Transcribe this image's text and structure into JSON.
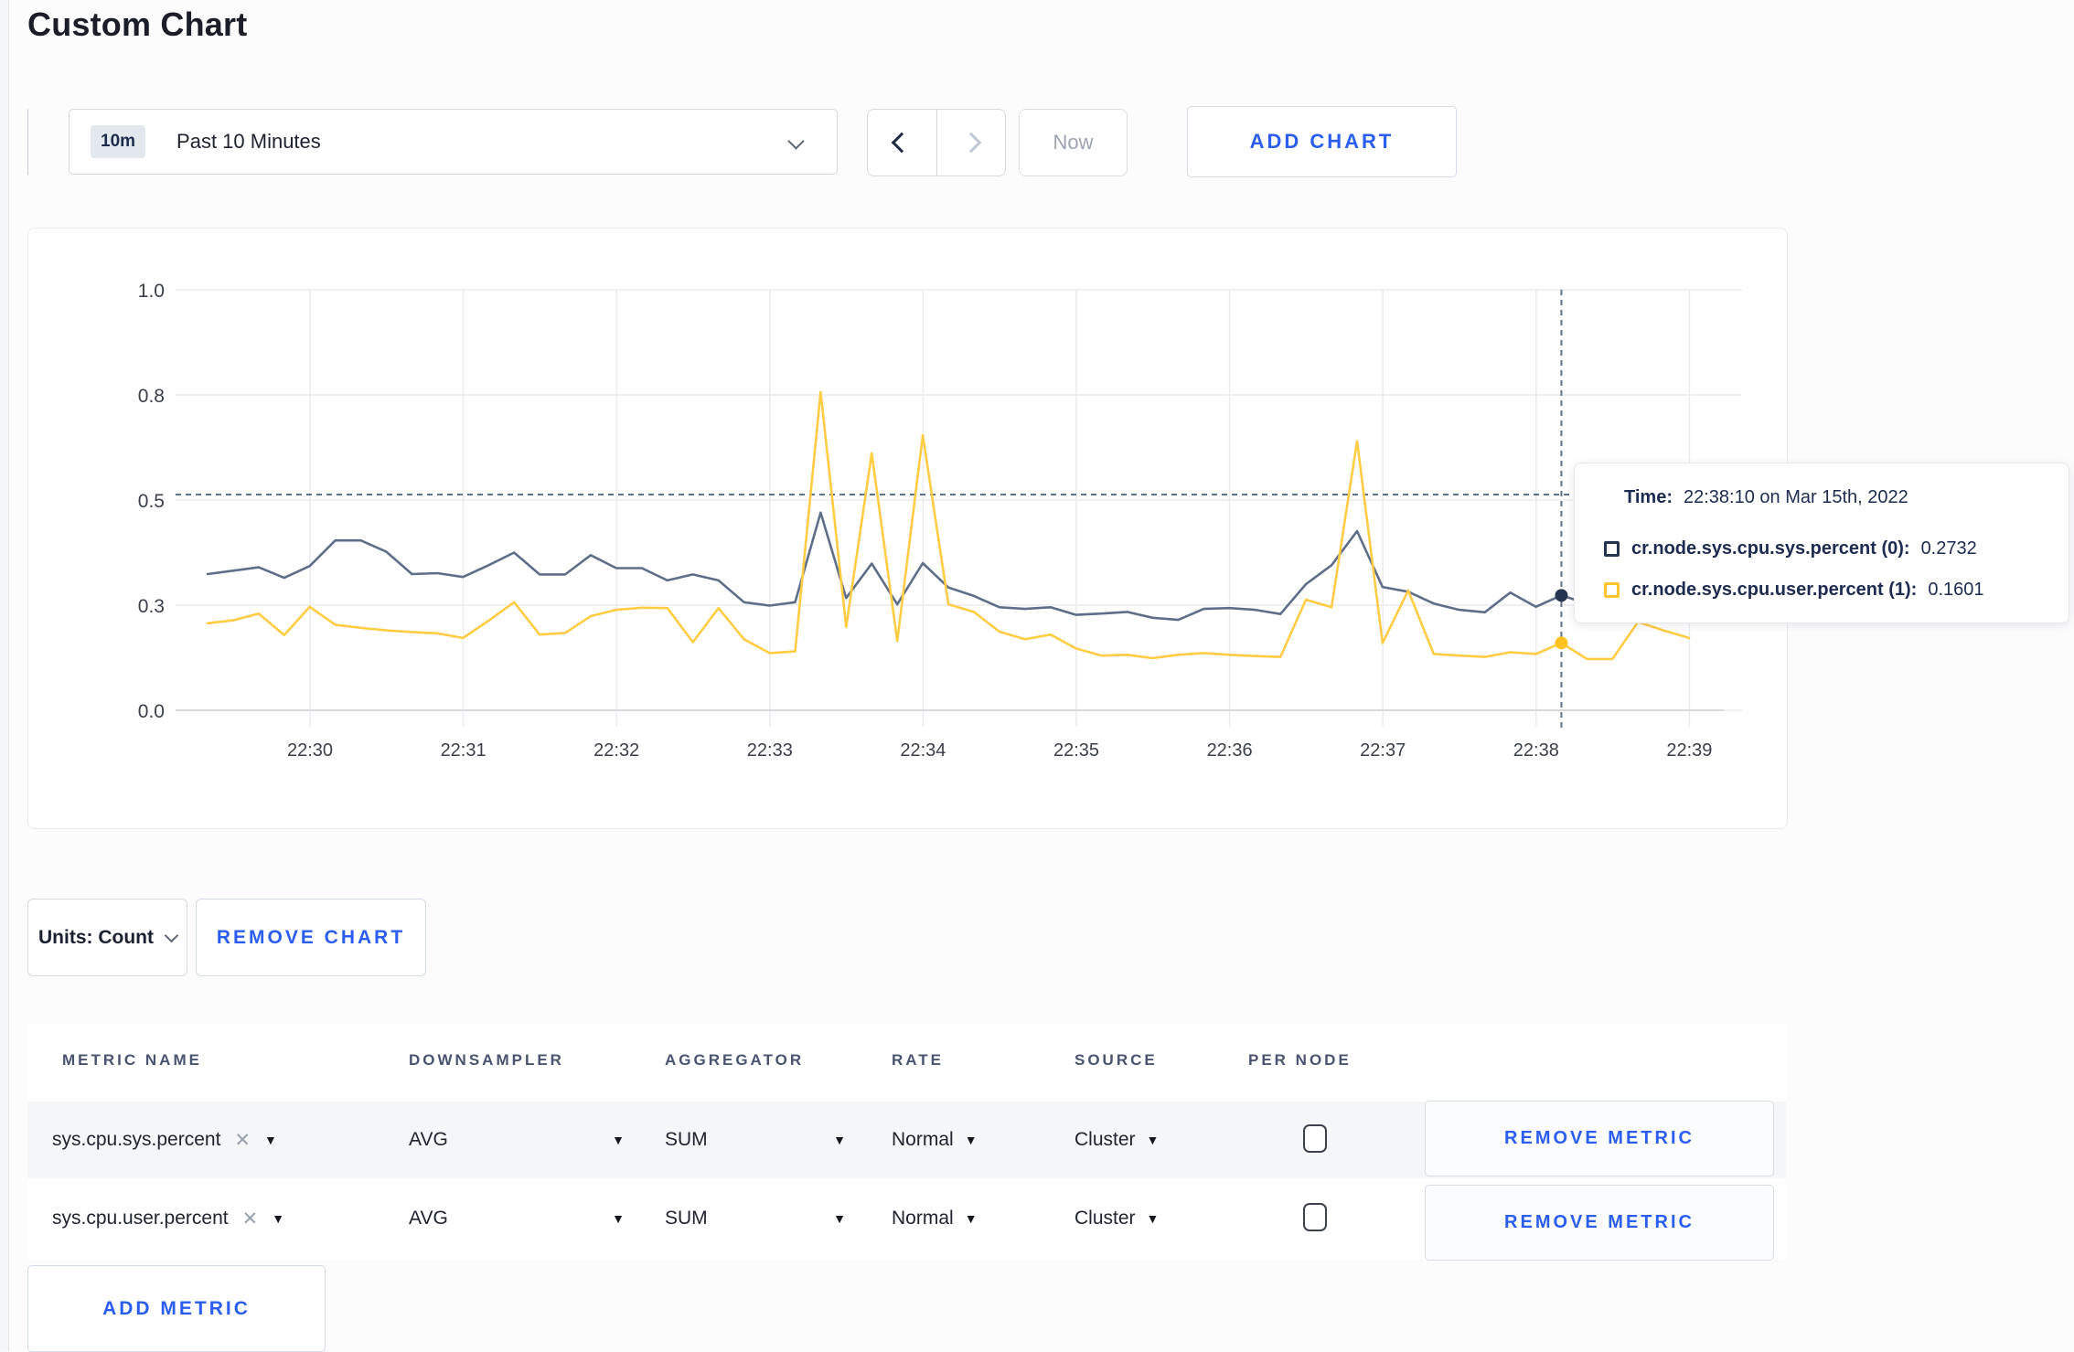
{
  "page": {
    "title": "Custom Chart"
  },
  "toolbar": {
    "time_range": {
      "badge": "10m",
      "label": "Past 10 Minutes"
    },
    "now_label": "Now",
    "add_chart_label": "ADD CHART"
  },
  "chart": {
    "tooltip": {
      "time_label": "Time:",
      "time_value": "22:38:10 on Mar 15th, 2022",
      "series": [
        {
          "name": "cr.node.sys.cpu.sys.percent (0):",
          "value": "0.2732",
          "color": "#26344f"
        },
        {
          "name": "cr.node.sys.cpu.user.percent (1):",
          "value": "0.1601",
          "color": "#ffc52e"
        }
      ]
    }
  },
  "chart_data": {
    "type": "line",
    "title": "",
    "xlabel": "",
    "ylabel": "",
    "ylim": [
      0,
      1
    ],
    "grid": true,
    "guide_value": 0.513,
    "y_ticks": [
      {
        "v": 0,
        "label": "0.0"
      },
      {
        "v": 0.25,
        "label": "0.3"
      },
      {
        "v": 0.5,
        "label": "0.5"
      },
      {
        "v": 0.75,
        "label": "0.8"
      },
      {
        "v": 1,
        "label": "1.0"
      }
    ],
    "x_tick_labels": [
      "22:30",
      "22:31",
      "22:32",
      "22:33",
      "22:34",
      "22:35",
      "22:36",
      "22:37",
      "22:38",
      "22:39"
    ],
    "x": [
      "22:29:20",
      "22:29:30",
      "22:29:40",
      "22:29:50",
      "22:30:00",
      "22:30:10",
      "22:30:20",
      "22:30:30",
      "22:30:40",
      "22:30:50",
      "22:31:00",
      "22:31:10",
      "22:31:20",
      "22:31:30",
      "22:31:40",
      "22:31:50",
      "22:32:00",
      "22:32:10",
      "22:32:20",
      "22:32:30",
      "22:32:40",
      "22:32:50",
      "22:33:00",
      "22:33:10",
      "22:33:20",
      "22:33:30",
      "22:33:40",
      "22:33:50",
      "22:34:00",
      "22:34:10",
      "22:34:20",
      "22:34:30",
      "22:34:40",
      "22:34:50",
      "22:35:00",
      "22:35:10",
      "22:35:20",
      "22:35:30",
      "22:35:40",
      "22:35:50",
      "22:36:00",
      "22:36:10",
      "22:36:20",
      "22:36:30",
      "22:36:40",
      "22:36:50",
      "22:37:00",
      "22:37:10",
      "22:37:20",
      "22:37:30",
      "22:37:40",
      "22:37:50",
      "22:38:00",
      "22:38:10",
      "22:38:20",
      "22:38:30",
      "22:38:40",
      "22:38:50",
      "22:39:00"
    ],
    "series": [
      {
        "id": "sys",
        "name": "cr.node.sys.cpu.sys.percent",
        "color": "#5f6e88",
        "dot": "#26344f",
        "values": [
          0.324,
          0.332,
          0.34,
          0.315,
          0.343,
          0.404,
          0.404,
          0.377,
          0.324,
          0.326,
          0.317,
          0.345,
          0.375,
          0.323,
          0.323,
          0.369,
          0.338,
          0.338,
          0.309,
          0.323,
          0.309,
          0.257,
          0.249,
          0.257,
          0.47,
          0.267,
          0.349,
          0.252,
          0.35,
          0.292,
          0.272,
          0.245,
          0.241,
          0.245,
          0.227,
          0.23,
          0.234,
          0.22,
          0.215,
          0.241,
          0.243,
          0.239,
          0.229,
          0.3,
          0.345,
          0.426,
          0.293,
          0.282,
          0.254,
          0.239,
          0.233,
          0.28,
          0.246,
          0.2732,
          0.254,
          0.26,
          0.27,
          0.265,
          0.27
        ]
      },
      {
        "id": "user",
        "name": "cr.node.sys.cpu.user.percent",
        "color": "#ffcc44",
        "dot": "#ffc21e",
        "values": [
          0.207,
          0.214,
          0.23,
          0.179,
          0.246,
          0.203,
          0.196,
          0.19,
          0.186,
          0.183,
          0.172,
          0.213,
          0.257,
          0.18,
          0.184,
          0.224,
          0.239,
          0.244,
          0.243,
          0.162,
          0.243,
          0.169,
          0.136,
          0.14,
          0.757,
          0.198,
          0.611,
          0.165,
          0.654,
          0.252,
          0.234,
          0.187,
          0.169,
          0.18,
          0.147,
          0.13,
          0.132,
          0.124,
          0.132,
          0.136,
          0.132,
          0.129,
          0.127,
          0.263,
          0.245,
          0.64,
          0.16,
          0.285,
          0.134,
          0.13,
          0.127,
          0.138,
          0.134,
          0.1601,
          0.122,
          0.122,
          0.21,
          0.19,
          0.172
        ]
      }
    ],
    "hover": {
      "time": "22:38:10",
      "values": [
        0.2732,
        0.1601
      ]
    },
    "legend_position": "tooltip"
  },
  "controls": {
    "units_label": "Units: Count",
    "remove_chart_label": "REMOVE CHART",
    "add_metric_label": "ADD METRIC"
  },
  "table": {
    "headers": [
      "METRIC NAME",
      "DOWNSAMPLER",
      "AGGREGATOR",
      "RATE",
      "SOURCE",
      "PER NODE"
    ],
    "rows": [
      {
        "metric": "sys.cpu.sys.percent",
        "clear": "✕",
        "downsampler": "AVG",
        "aggregator": "SUM",
        "rate": "Normal",
        "source": "Cluster",
        "per_node_checked": false,
        "remove_label": "REMOVE METRIC"
      },
      {
        "metric": "sys.cpu.user.percent",
        "clear": "✕",
        "downsampler": "AVG",
        "aggregator": "SUM",
        "rate": "Normal",
        "source": "Cluster",
        "per_node_checked": false,
        "remove_label": "REMOVE METRIC"
      }
    ]
  }
}
